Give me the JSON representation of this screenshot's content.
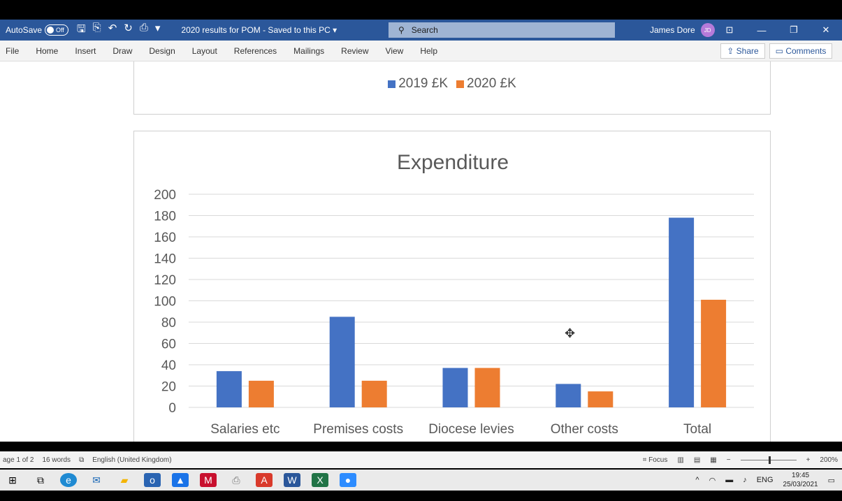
{
  "titlebar": {
    "autosave_label": "AutoSave",
    "autosave_state": "Off",
    "doc_title": "2020 results for POM  -  Saved to this PC ▾",
    "search_placeholder": "Search",
    "user_name": "James Dore",
    "user_initials": "JD"
  },
  "menu": {
    "tabs": [
      "File",
      "Home",
      "Insert",
      "Draw",
      "Design",
      "Layout",
      "References",
      "Mailings",
      "Review",
      "View",
      "Help"
    ],
    "share_label": "Share",
    "comments_label": "Comments"
  },
  "chart1": {
    "legend": [
      {
        "label": "2019 £K",
        "color": "#4472c4"
      },
      {
        "label": "2020 £K",
        "color": "#ed7d31"
      }
    ]
  },
  "chart_data": {
    "type": "bar",
    "title": "Expenditure",
    "categories": [
      "Salaries etc",
      "Premises costs",
      "Diocese levies",
      "Other costs",
      "Total"
    ],
    "series": [
      {
        "name": "2019 £K",
        "values": [
          34,
          85,
          37,
          22,
          178
        ],
        "color": "#4472c4"
      },
      {
        "name": "2020 £K",
        "values": [
          25,
          25,
          37,
          15,
          101
        ],
        "color": "#ed7d31"
      }
    ],
    "yticks": [
      "0",
      "20",
      "40",
      "60",
      "80",
      "100",
      "120",
      "140",
      "160",
      "180",
      "200"
    ],
    "ylim": [
      0,
      200
    ],
    "grid": true
  },
  "statusbar": {
    "page": "age 1 of 2",
    "words": "16 words",
    "language": "English (United Kingdom)",
    "focus": "Focus",
    "zoom": "200%"
  },
  "taskbar": {
    "lang": "ENG",
    "time": "19:45",
    "date": "25/03/2021"
  }
}
